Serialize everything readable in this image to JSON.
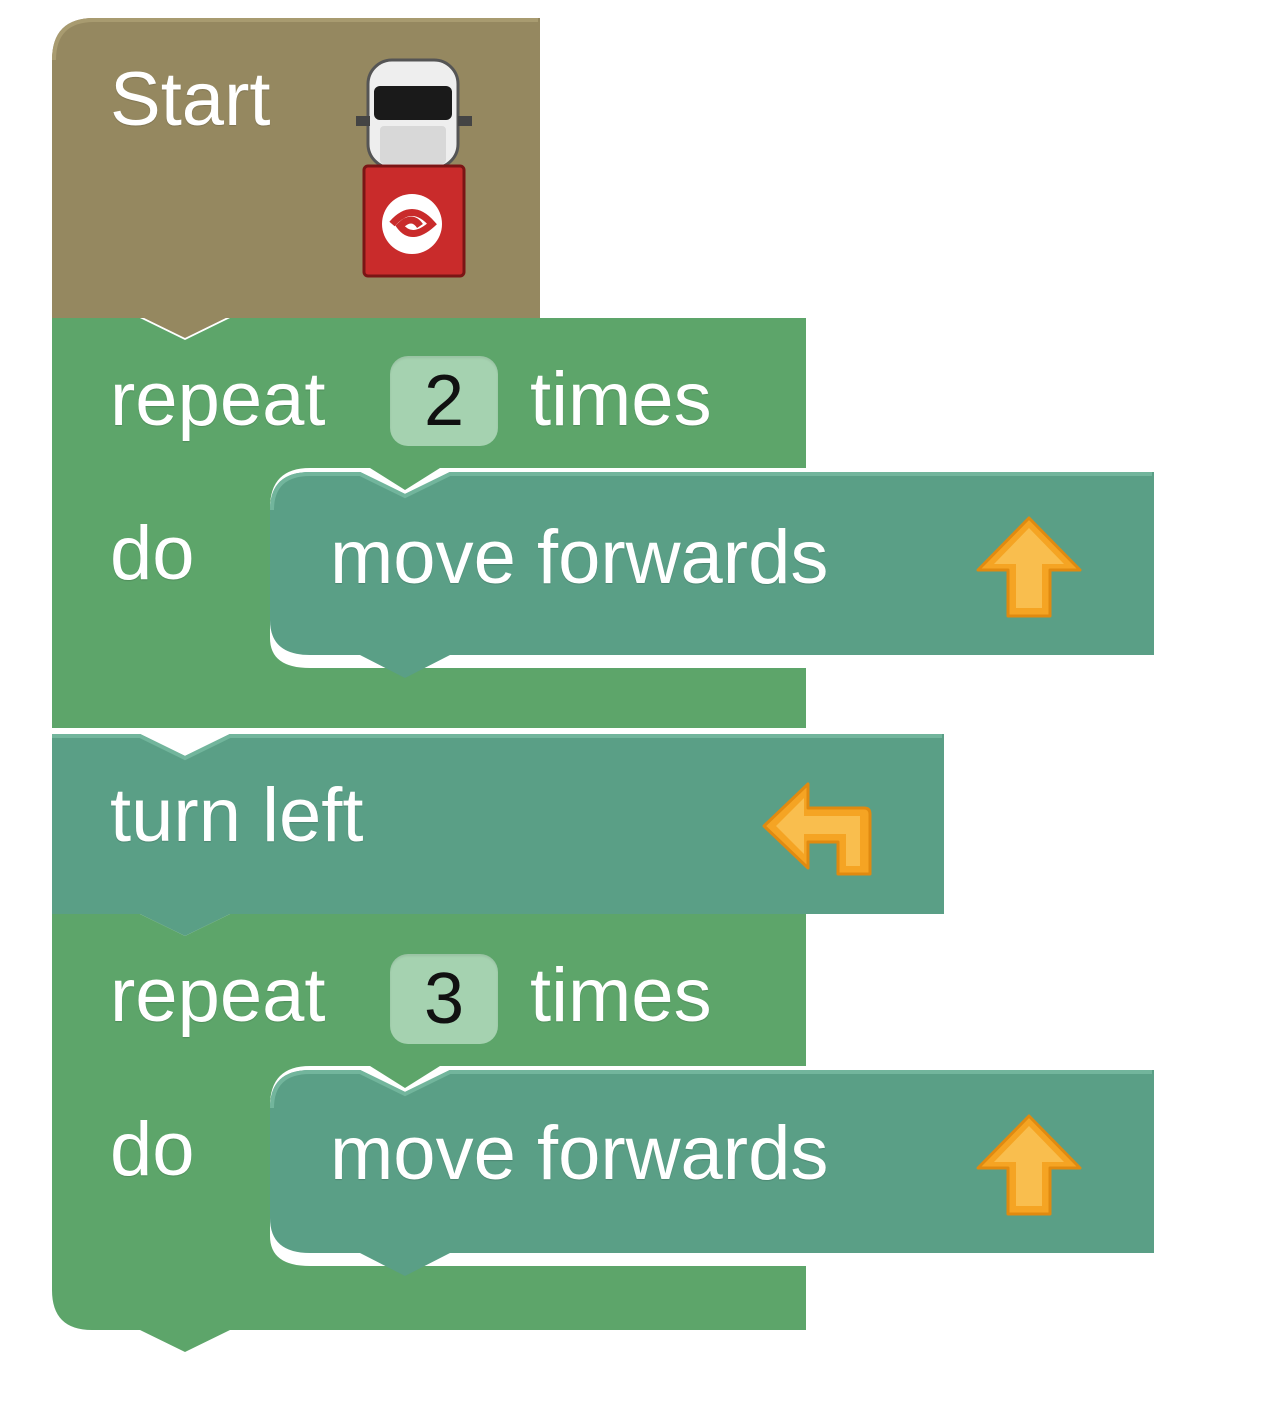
{
  "colors": {
    "start_block": "#958860",
    "start_block_light": "#a89b70",
    "loop_block": "#5da56a",
    "loop_block_light": "#74b881",
    "action_block": "#5a9f86",
    "action_block_light": "#72b59c",
    "number_field": "#a5d2b0",
    "arrow_icon": "#f5a423",
    "car_body": "#c92b2b"
  },
  "program": {
    "start": {
      "label": "Start",
      "icon": "car-icon"
    },
    "blocks": [
      {
        "type": "repeat",
        "repeat_label": "repeat",
        "count": "2",
        "times_label": "times",
        "do_label": "do",
        "body": {
          "label": "move forwards",
          "icon": "arrow-up-icon"
        }
      },
      {
        "type": "action",
        "label": "turn left",
        "icon": "turn-left-arrow-icon"
      },
      {
        "type": "repeat",
        "repeat_label": "repeat",
        "count": "3",
        "times_label": "times",
        "do_label": "do",
        "body": {
          "label": "move forwards",
          "icon": "arrow-up-icon"
        }
      }
    ]
  }
}
